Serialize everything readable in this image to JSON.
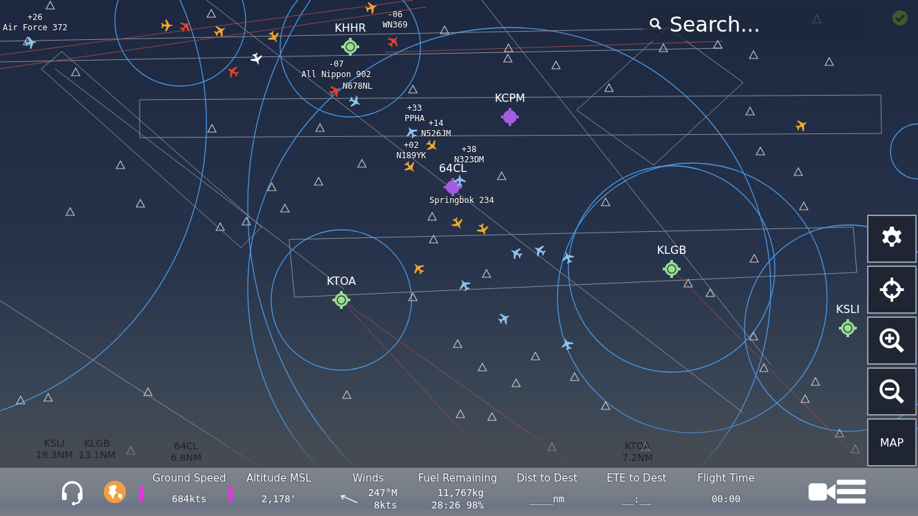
{
  "search": {
    "placeholder": "Search..."
  },
  "airports": [
    {
      "ident": "KHHR",
      "color": "#9be08f"
    },
    {
      "ident": "KCPM",
      "color": "#a35ee0"
    },
    {
      "ident": "64CL",
      "color": "#a35ee0"
    },
    {
      "ident": "KTOA",
      "color": "#9be08f"
    },
    {
      "ident": "KLGB",
      "color": "#9be08f"
    },
    {
      "ident": "KSLI",
      "color": "#9be08f"
    }
  ],
  "aircraft": [
    {
      "altitude": "+26",
      "callsign": "Air Force 372",
      "color": "#8ec5f0"
    },
    {
      "altitude": "-06",
      "callsign": "WN369",
      "color": "#e8402a"
    },
    {
      "altitude": "-07",
      "callsign": "All Nippon 902",
      "color": "#ffffff"
    },
    {
      "callsign": "N678NL",
      "color": "#e8402a"
    },
    {
      "altitude": "+33",
      "callsign": "PPHA",
      "color": "#8ec5f0"
    },
    {
      "altitude": "+14",
      "callsign": "N526JM",
      "color": "#f0a830"
    },
    {
      "altitude": "+02",
      "callsign": "N189YK",
      "color": "#f0a830"
    },
    {
      "altitude": "+38",
      "callsign": "N323DM",
      "color": "#8ec5f0"
    },
    {
      "callsign": "Springbok 234",
      "color": "#f0a830"
    }
  ],
  "traffic": [
    {
      "color": "#f0a830"
    },
    {
      "color": "#f0a830"
    },
    {
      "color": "#f0a830"
    },
    {
      "color": "#f0a830"
    },
    {
      "color": "#e8402a"
    },
    {
      "color": "#e8402a"
    },
    {
      "color": "#8ec5f0"
    },
    {
      "color": "#8ec5f0"
    },
    {
      "color": "#8ec5f0"
    },
    {
      "color": "#8ec5f0"
    },
    {
      "color": "#8ec5f0"
    },
    {
      "color": "#8ec5f0"
    },
    {
      "color": "#8ec5f0"
    },
    {
      "color": "#f0a830"
    },
    {
      "color": "#f0a830"
    },
    {
      "color": "#f0a830"
    }
  ],
  "distances": [
    {
      "ident": "KSLI",
      "distance": "18.3NM"
    },
    {
      "ident": "KLGB",
      "distance": "13.1NM"
    },
    {
      "ident": "64CL",
      "distance": "6.8NM"
    },
    {
      "ident": "KTOA",
      "distance": "7.2NM"
    }
  ],
  "map_button": "MAP",
  "stats": [
    {
      "label": "Ground Speed",
      "values": [
        "684kts"
      ]
    },
    {
      "label": "Altitude MSL",
      "values": [
        "2,178'"
      ]
    },
    {
      "label": "Winds",
      "values": [
        "247°M",
        "8kts"
      ]
    },
    {
      "label": "Fuel Remaining",
      "values": [
        "11,767kg",
        "28:26 98%"
      ]
    },
    {
      "label": "Dist to Dest",
      "values": [
        "____nm"
      ]
    },
    {
      "label": "ETE to Dest",
      "values": [
        "__:__"
      ]
    },
    {
      "label": "Flight Time",
      "values": [
        "00:00"
      ]
    }
  ]
}
